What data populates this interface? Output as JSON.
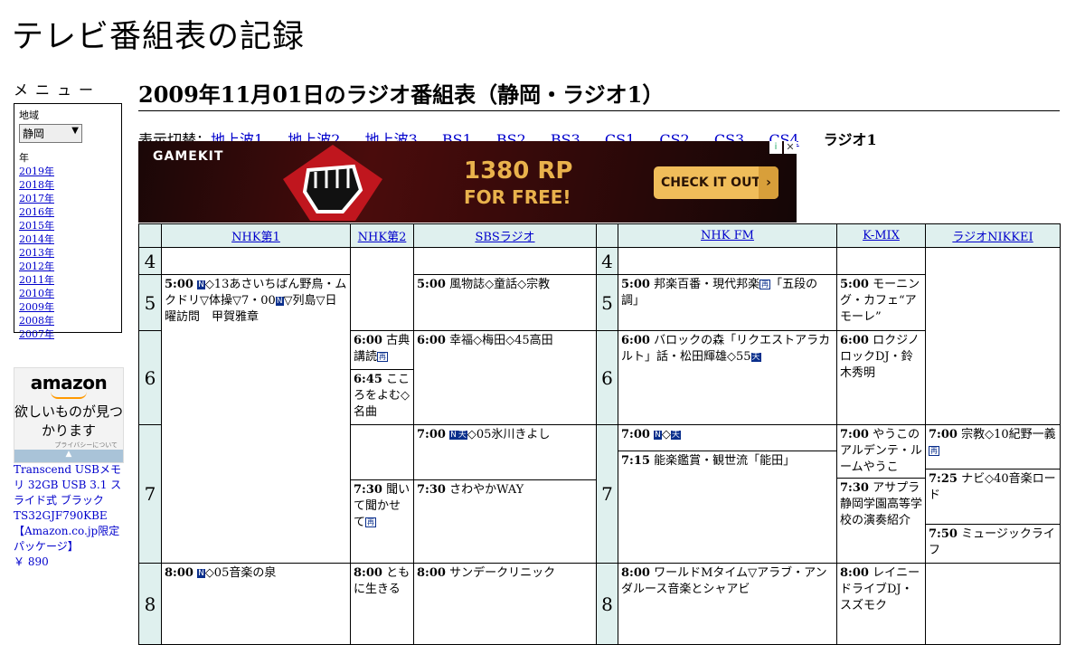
{
  "site": {
    "title": "テレビ番組表の記録"
  },
  "sidebar": {
    "menu_heading": "メニュー",
    "region_label": "地域",
    "region_value": "静岡",
    "year_label": "年",
    "years": [
      "2019年",
      "2018年",
      "2017年",
      "2016年",
      "2015年",
      "2014年",
      "2013年",
      "2012年",
      "2011年",
      "2010年",
      "2009年",
      "2008年",
      "2007年"
    ]
  },
  "amazon_ad": {
    "logo": "amazon",
    "tagline": "欲しいものが見つかります",
    "privacy": "プライバシーについて",
    "product_name": "Transcend USBメモリ 32GB USB 3.1 スライド式 ブラック TS32GJF790KBE 【Amazon.co.jp限定パッケージ】",
    "price": "￥ 890"
  },
  "main": {
    "heading": "2009年11月01日のラジオ番組表（静岡・ラジオ1）",
    "switcher_prefix": "表示切替：",
    "switcher_links": [
      "地上波1",
      "地上波2",
      "地上波3",
      "BS1",
      "BS2",
      "BS3",
      "CS1",
      "CS2",
      "CS3",
      "CS4"
    ],
    "switcher_current": "ラジオ1"
  },
  "banner_ad": {
    "logo": "GAMEKIT",
    "amount": "1380 RP",
    "subtitle": "FOR FREE!",
    "cta": "CHECK IT OUT",
    "colors": {
      "background": "#160707",
      "accent": "#e9b24c",
      "cta": "#f0bd5a"
    }
  },
  "schedule": {
    "channels": [
      "NHK第1",
      "NHK第2",
      "SBSラジオ",
      "NHK FM",
      "K-MIX",
      "ラジオNIKKEI"
    ],
    "hours": [
      "4",
      "5",
      "6",
      "7",
      "8"
    ],
    "programs": {
      "nhk1_5": {
        "time": "5:00",
        "text": "◇13あさいちばん野鳥・ムクドリ▽体操▽7・00",
        "text2": "▽列島▽日曜訪問　甲賀雅章"
      },
      "nhk1_8": {
        "time": "8:00",
        "text": "◇05音楽の泉"
      },
      "nhk2_6": {
        "time": "6:00",
        "text": "古典講読"
      },
      "nhk2_645": {
        "time": "6:45",
        "text": "こころをよむ◇名曲"
      },
      "nhk2_730": {
        "time": "7:30",
        "text": "聞いて聞かせて"
      },
      "nhk2_8": {
        "time": "8:00",
        "text": "ともに生きる"
      },
      "sbs_5": {
        "time": "5:00",
        "text": "風物誌◇童話◇宗教"
      },
      "sbs_6": {
        "time": "6:00",
        "text": "幸福◇梅田◇45高田"
      },
      "sbs_7": {
        "time": "7:00",
        "text": "◇05氷川きよし"
      },
      "sbs_730": {
        "time": "7:30",
        "text": "さわやかWAY"
      },
      "sbs_8": {
        "time": "8:00",
        "text": "サンデークリニック"
      },
      "fm_5": {
        "time": "5:00",
        "text": "邦楽百番・現代邦楽",
        "text2": "「五段の調」"
      },
      "fm_6": {
        "time": "6:00",
        "text": "バロックの森「リクエストアラカルト」話・松田輝雄◇55"
      },
      "fm_7": {
        "time": "7:00",
        "text": "◇"
      },
      "fm_715": {
        "time": "7:15",
        "text": "能楽鑑賞・観世流「能田」"
      },
      "fm_8": {
        "time": "8:00",
        "text": "ワールドMタイム▽アラブ・アンダルース音楽とシャアビ"
      },
      "kmix_5": {
        "time": "5:00",
        "text": "モーニング・カフェ“アモーレ”"
      },
      "kmix_6": {
        "time": "6:00",
        "text": "ロクジノロックDJ・鈴木秀明"
      },
      "kmix_7": {
        "time": "7:00",
        "text": "やうこのアルデンテ・ルームやうこ"
      },
      "kmix_730": {
        "time": "7:30",
        "text": "アサプラ静岡学園高等学校の演奏紹介"
      },
      "kmix_8": {
        "time": "8:00",
        "text": "レイニードライブDJ・スズモク"
      },
      "nikkei_7": {
        "time": "7:00",
        "text": "宗教◇10紀野一義"
      },
      "nikkei_725": {
        "time": "7:25",
        "text": "ナビ◇40音楽ロード"
      },
      "nikkei_750": {
        "time": "7:50",
        "text": "ミュージックライフ"
      }
    },
    "badges": {
      "news": "N",
      "weather": "天",
      "rebroadcast": "再"
    }
  }
}
